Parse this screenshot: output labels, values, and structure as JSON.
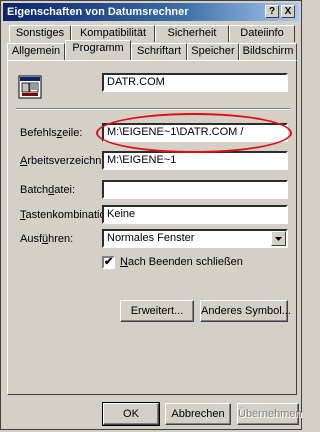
{
  "window": {
    "title": "Eigenschaften von Datumsrechner",
    "help_glyph": "?",
    "close_glyph": "X"
  },
  "tabs": {
    "row1": [
      "Sonstiges",
      "Kompatibilität",
      "Sicherheit",
      "Dateiinfo"
    ],
    "row2": [
      "Allgemein",
      "Programm",
      "Schriftart",
      "Speicher",
      "Bildschirm"
    ],
    "active": "Programm"
  },
  "program": {
    "name_value": "DATR.COM",
    "icon": "ms-dos-program-icon"
  },
  "fields": {
    "befehlszeile_label_a": "Befehls",
    "befehlszeile_label_u": "z",
    "befehlszeile_label_b": "eile:",
    "befehlszeile_value": "M:\\EIGENE~1\\DATR.COM /",
    "arbeits_label_u": "A",
    "arbeits_label_b": "rbeitsverzeichnis:",
    "arbeits_value": "M:\\EIGENE~1",
    "batch_label_a": "Batch",
    "batch_label_u": "d",
    "batch_label_b": "atei:",
    "batch_value": "",
    "tasten_label_u": "T",
    "tasten_label_b": "astenkombination:",
    "tasten_value": "Keine",
    "ausfuehren_label_a": "Ausf",
    "ausfuehren_label_u": "ü",
    "ausfuehren_label_b": "hren:",
    "ausfuehren_value": "Normales Fenster"
  },
  "checkbox": {
    "label_u": "N",
    "label_b": "ach Beenden schließen",
    "checked_glyph": "✔"
  },
  "buttons": {
    "erweitert": "Erweitert...",
    "anderes_symbol": "Anderes Symbol...",
    "ok": "OK",
    "abbrechen": "Abbrechen",
    "uebernehmen": "Übernehmen"
  },
  "colors": {
    "highlight_ellipse": "#e01010",
    "title_bar": "#0a246a"
  }
}
